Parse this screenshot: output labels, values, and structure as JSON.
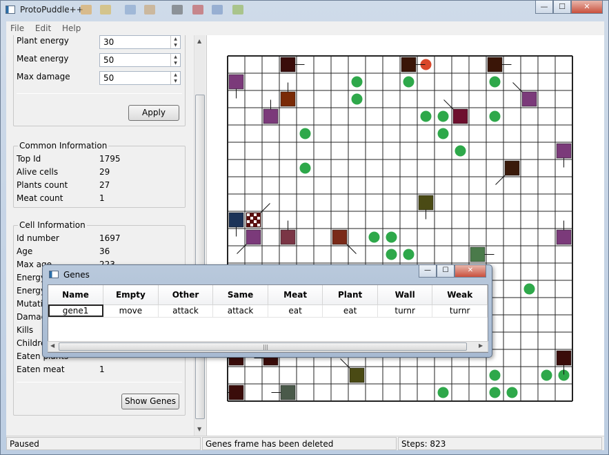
{
  "window": {
    "title": "ProtoPuddle++",
    "buttons": {
      "minimize": "—",
      "maximize": "☐",
      "close": "✕"
    }
  },
  "menu": [
    "File",
    "Edit",
    "Help"
  ],
  "settings": {
    "fields": [
      {
        "label": "Plant energy",
        "value": "30"
      },
      {
        "label": "Meat energy",
        "value": "50"
      },
      {
        "label": "Max damage",
        "value": "50"
      }
    ],
    "apply_label": "Apply"
  },
  "common_info": {
    "title": "Common Information",
    "rows": [
      {
        "label": "Top Id",
        "value": "1795"
      },
      {
        "label": "Alive cells",
        "value": "29"
      },
      {
        "label": "Plants count",
        "value": "27"
      },
      {
        "label": "Meat count",
        "value": "1"
      }
    ]
  },
  "cell_info": {
    "title": "Cell Information",
    "rows": [
      {
        "label": "Id number",
        "value": "1697"
      },
      {
        "label": "Age",
        "value": "36"
      },
      {
        "label": "Max age",
        "value": "223"
      },
      {
        "label": "Energy",
        "value": ""
      },
      {
        "label": "Energy",
        "value": ""
      },
      {
        "label": "Mutatio",
        "value": ""
      },
      {
        "label": "Damag",
        "value": ""
      },
      {
        "label": "Kills",
        "value": ""
      },
      {
        "label": "Childre",
        "value": ""
      },
      {
        "label": "Eaten plants",
        "value": ""
      },
      {
        "label": "Eaten meat",
        "value": "1"
      }
    ],
    "show_genes_label": "Show Genes"
  },
  "status": {
    "state": "Paused",
    "message": "Genes frame has been deleted",
    "steps": "Steps: 823"
  },
  "genes_dialog": {
    "title": "Genes",
    "columns": [
      "Name",
      "Empty",
      "Other",
      "Same",
      "Meat",
      "Plant",
      "Wall",
      "Weak"
    ],
    "rows": [
      [
        "gene1",
        "move",
        "attack",
        "attack",
        "eat",
        "eat",
        "turnr",
        "turnr"
      ]
    ]
  },
  "colors": {
    "plant": "#2ea84a",
    "meat": "#d9472b",
    "grid_line": "#222222"
  },
  "world": {
    "grid_rows": 20,
    "grid_cols": 20,
    "plants": [
      [
        7,
        1
      ],
      [
        10,
        1
      ],
      [
        15,
        1
      ],
      [
        7,
        2
      ],
      [
        11,
        3
      ],
      [
        12,
        3
      ],
      [
        15,
        3
      ],
      [
        4,
        4
      ],
      [
        12,
        4
      ],
      [
        13,
        5
      ],
      [
        4,
        6
      ],
      [
        9,
        10
      ],
      [
        8,
        10
      ],
      [
        9,
        11
      ],
      [
        10,
        11
      ],
      [
        14,
        14
      ],
      [
        17,
        13
      ],
      [
        19,
        18
      ],
      [
        15,
        18
      ],
      [
        18,
        18
      ],
      [
        16,
        19
      ],
      [
        12,
        19
      ],
      [
        15,
        19
      ]
    ],
    "meat": [
      [
        11,
        0
      ]
    ],
    "cells": [
      {
        "col": 3,
        "row": 0,
        "color": "#3a0c0a",
        "dir": "E"
      },
      {
        "col": 10,
        "row": 0,
        "color": "#3a1507",
        "dir": "E"
      },
      {
        "col": 15,
        "row": 0,
        "color": "#3a1507",
        "dir": "E"
      },
      {
        "col": 0,
        "row": 1,
        "color": "#7b3a7a",
        "dir": "S"
      },
      {
        "col": 3,
        "row": 2,
        "color": "#7a2a06",
        "dir": "N"
      },
      {
        "col": 17,
        "row": 2,
        "color": "#7b3a7a",
        "dir": "NW"
      },
      {
        "col": 2,
        "row": 3,
        "color": "#7b3a7a",
        "dir": "N"
      },
      {
        "col": 13,
        "row": 3,
        "color": "#6e0f2e",
        "dir": "NW"
      },
      {
        "col": 19,
        "row": 5,
        "color": "#7b3a7a",
        "dir": "S"
      },
      {
        "col": 16,
        "row": 6,
        "color": "#3a1a0a",
        "dir": "SW"
      },
      {
        "col": 11,
        "row": 8,
        "color": "#4a4a14",
        "dir": "S"
      },
      {
        "col": 0,
        "row": 9,
        "color": "#1c3358",
        "dir": "S"
      },
      {
        "col": 1,
        "row": 9,
        "color": "#5a0f0f",
        "dir": "NE",
        "checkered": true
      },
      {
        "col": 1,
        "row": 10,
        "color": "#7b3a7a",
        "dir": "SW"
      },
      {
        "col": 3,
        "row": 10,
        "color": "#7a3545",
        "dir": "N"
      },
      {
        "col": 6,
        "row": 10,
        "color": "#7a2a18",
        "dir": "SE"
      },
      {
        "col": 19,
        "row": 10,
        "color": "#7b3a7a",
        "dir": "N"
      },
      {
        "col": 14,
        "row": 11,
        "color": "#4a7a4a",
        "dir": "E"
      },
      {
        "col": 0,
        "row": 17,
        "color": "#3a0c0a",
        "dir": "W"
      },
      {
        "col": 2,
        "row": 17,
        "color": "#3a0c0a",
        "dir": "W"
      },
      {
        "col": 19,
        "row": 17,
        "color": "#3a0c0a",
        "dir": "S"
      },
      {
        "col": 7,
        "row": 18,
        "color": "#4a4a14",
        "dir": "NW"
      },
      {
        "col": 0,
        "row": 19,
        "color": "#3a0c0a",
        "dir": "W"
      },
      {
        "col": 3,
        "row": 19,
        "color": "#4a5a4a",
        "dir": "W"
      }
    ]
  }
}
